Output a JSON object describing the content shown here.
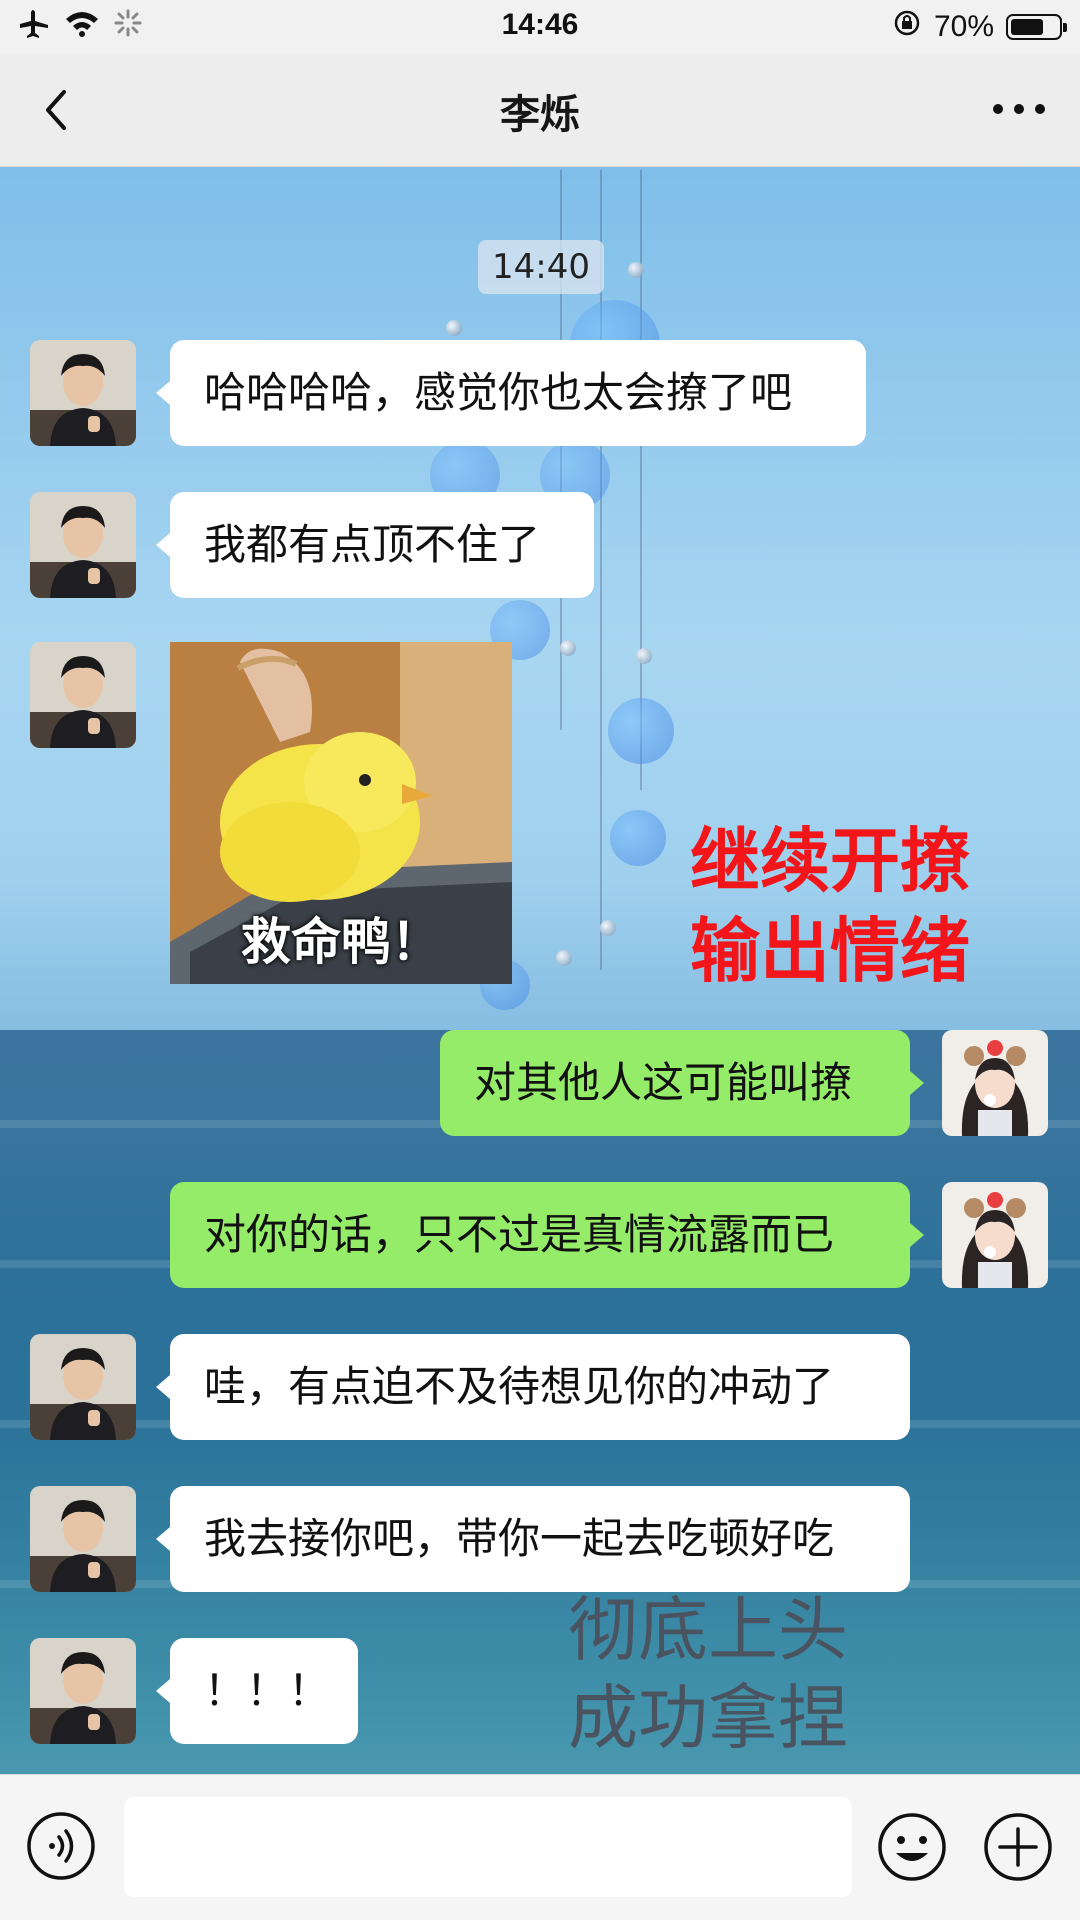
{
  "status_bar": {
    "time": "14:46",
    "battery_percent": "70%",
    "battery_level": 0.7,
    "icons": [
      "airplane-icon",
      "wifi-icon",
      "loading-icon",
      "orientation-lock-icon",
      "battery-icon"
    ]
  },
  "header": {
    "title": "李烁",
    "icons": [
      "chevron-left-icon",
      "more-icon"
    ]
  },
  "chat": {
    "timestamp": "14:40",
    "messages": [
      {
        "side": "left",
        "text": "哈哈哈哈，感觉你也太会撩了吧"
      },
      {
        "side": "left",
        "text": "我都有点顶不住了"
      },
      {
        "side": "left",
        "type": "sticker",
        "caption": "救命鸭！"
      },
      {
        "side": "right",
        "text": "对其他人这可能叫撩"
      },
      {
        "side": "right",
        "text": "对你的话，只不过是真情流露而已"
      },
      {
        "side": "left",
        "text": "哇，有点迫不及待想见你的冲动了"
      },
      {
        "side": "left",
        "text": "我去接你吧，带你一起去吃顿好吃"
      },
      {
        "side": "left",
        "text": "！！！"
      }
    ]
  },
  "annotations": {
    "red_line1": "继续开撩",
    "red_line2": "输出情绪",
    "gray_line1": "彻底上头",
    "gray_line2": "成功拿捏"
  },
  "input_bar": {
    "value": "",
    "icons": [
      "voice-icon",
      "emoji-icon",
      "plus-icon"
    ]
  },
  "colors": {
    "bubble_self": "#95ec69",
    "bubble_other": "#ffffff",
    "annotation_red": "#f2161a",
    "annotation_gray": "#4a5460",
    "nav_background": "#ededed"
  }
}
